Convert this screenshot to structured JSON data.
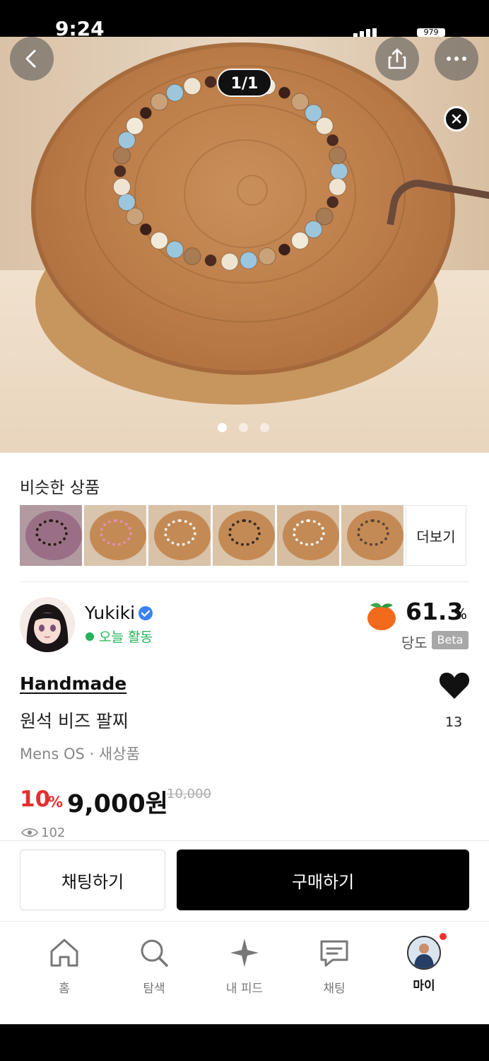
{
  "status_bar": {
    "time": "9:24",
    "battery": "979"
  },
  "photo": {
    "counter": "1/1",
    "dot_count": 3,
    "active_dot": 0
  },
  "similar": {
    "title": "비슷한 상품",
    "more_label": "더보기"
  },
  "seller": {
    "name": "Yukiki",
    "activity": "오늘 활동",
    "sweetness_value": "61.3",
    "sweetness_unit": "%",
    "sweetness_label": "당도",
    "beta": "Beta"
  },
  "product": {
    "brand": "Handmade",
    "name": "원석 비즈 팔찌",
    "meta": "Mens OS · 새상품",
    "discount": "10",
    "discount_unit": "%",
    "price": "9,000원",
    "original_price": "10,000",
    "likes": "13",
    "views": "102"
  },
  "actions": {
    "chat": "채팅하기",
    "buy": "구매하기"
  },
  "tabs": [
    {
      "label": "홈",
      "icon": "home-icon"
    },
    {
      "label": "탐색",
      "icon": "search-icon"
    },
    {
      "label": "내 피드",
      "icon": "sparkle-icon"
    },
    {
      "label": "채팅",
      "icon": "chat-icon"
    },
    {
      "label": "마이",
      "icon": "profile-icon"
    }
  ],
  "colors": {
    "sale_red": "#e52e2e",
    "active_green": "#22b356",
    "verified_blue": "#3b82f6",
    "orange": "#f26a1b"
  }
}
